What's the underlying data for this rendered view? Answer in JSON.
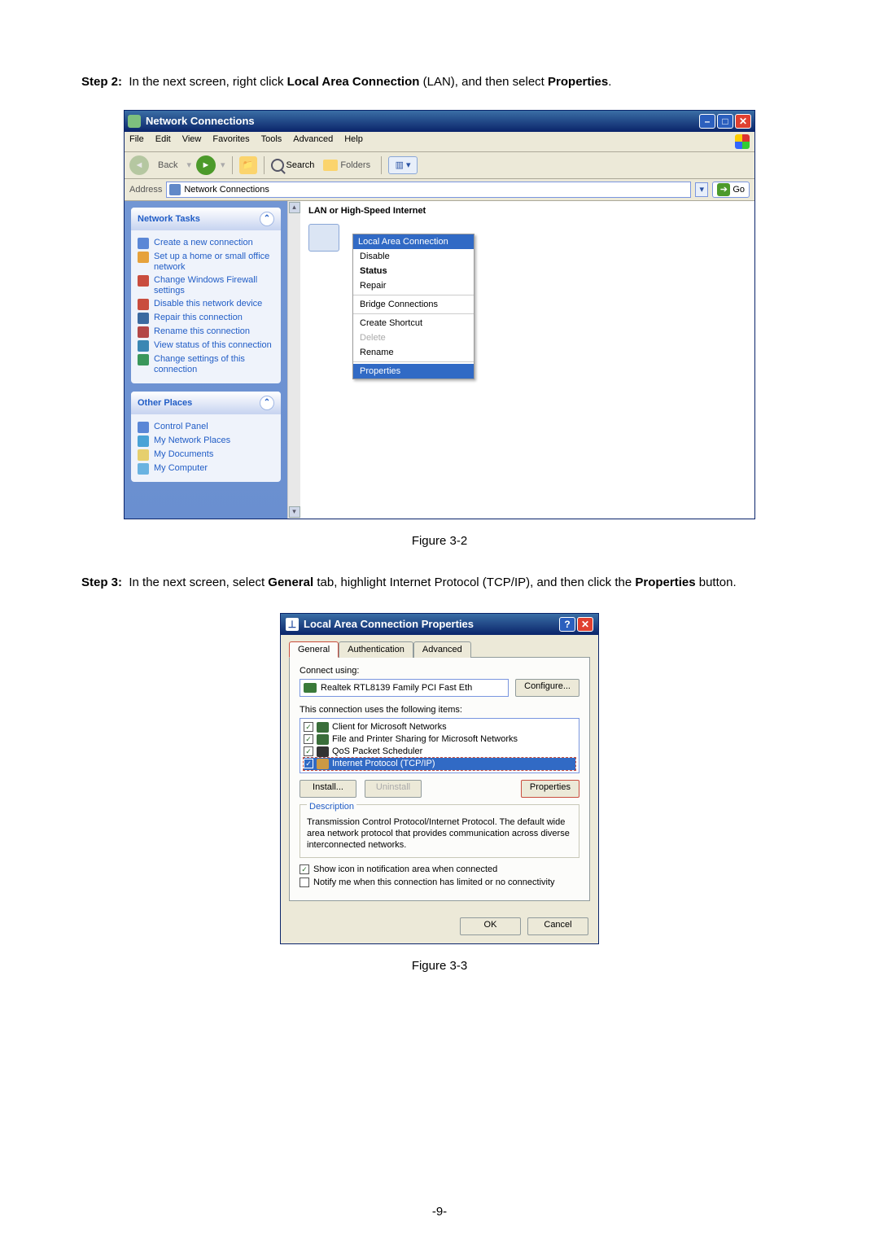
{
  "step2": {
    "label": "Step 2:",
    "text_a": "In the next screen, right click ",
    "bold_a": "Local Area Connection",
    "text_b": " (LAN), and then select ",
    "bold_b": "Properties",
    "text_c": "."
  },
  "fig2_caption": "Figure 3-2",
  "step3": {
    "label": "Step 3:",
    "text_a": "In the next screen, select ",
    "bold_a": "General",
    "text_b": " tab, highlight Internet Protocol (TCP/IP), and then click the ",
    "bold_b": "Properties",
    "text_c": " button."
  },
  "fig3_caption": "Figure 3-3",
  "page_number": "-9-",
  "win1": {
    "title": "Network Connections",
    "menu": {
      "file": "File",
      "edit": "Edit",
      "view": "View",
      "favorites": "Favorites",
      "tools": "Tools",
      "advanced": "Advanced",
      "help": "Help"
    },
    "toolbar": {
      "back": "Back",
      "search": "Search",
      "folders": "Folders"
    },
    "address_label": "Address",
    "address_value": "Network Connections",
    "go": "Go",
    "tasks_header": "Network Tasks",
    "tasks": {
      "t1": "Create a new connection",
      "t2": "Set up a home or small office network",
      "t3": "Change Windows Firewall settings",
      "t4": "Disable this network device",
      "t5": "Repair this connection",
      "t6": "Rename this connection",
      "t7": "View status of this connection",
      "t8": "Change settings of this connection"
    },
    "places_header": "Other Places",
    "places": {
      "p1": "Control Panel",
      "p2": "My Network Places",
      "p3": "My Documents",
      "p4": "My Computer"
    },
    "group_label": "LAN or High-Speed Internet",
    "context": {
      "title": "Local Area Connection",
      "disable": "Disable",
      "status": "Status",
      "repair": "Repair",
      "bridge": "Bridge Connections",
      "shortcut": "Create Shortcut",
      "delete": "Delete",
      "rename": "Rename",
      "properties": "Properties"
    }
  },
  "dlg": {
    "title": "Local Area Connection Properties",
    "tabs": {
      "general": "General",
      "auth": "Authentication",
      "advanced": "Advanced"
    },
    "connect_using": "Connect using:",
    "adapter": "Realtek RTL8139 Family PCI Fast Eth",
    "configure": "Configure...",
    "items_label": "This connection uses the following items:",
    "items": {
      "i1": "Client for Microsoft Networks",
      "i2": "File and Printer Sharing for Microsoft Networks",
      "i3": "QoS Packet Scheduler",
      "i4": "Internet Protocol (TCP/IP)"
    },
    "install": "Install...",
    "uninstall": "Uninstall",
    "properties": "Properties",
    "desc_legend": "Description",
    "desc": "Transmission Control Protocol/Internet Protocol. The default wide area network protocol that provides communication across diverse interconnected networks.",
    "show_icon": "Show icon in notification area when connected",
    "notify": "Notify me when this connection has limited or no connectivity",
    "ok": "OK",
    "cancel": "Cancel"
  }
}
